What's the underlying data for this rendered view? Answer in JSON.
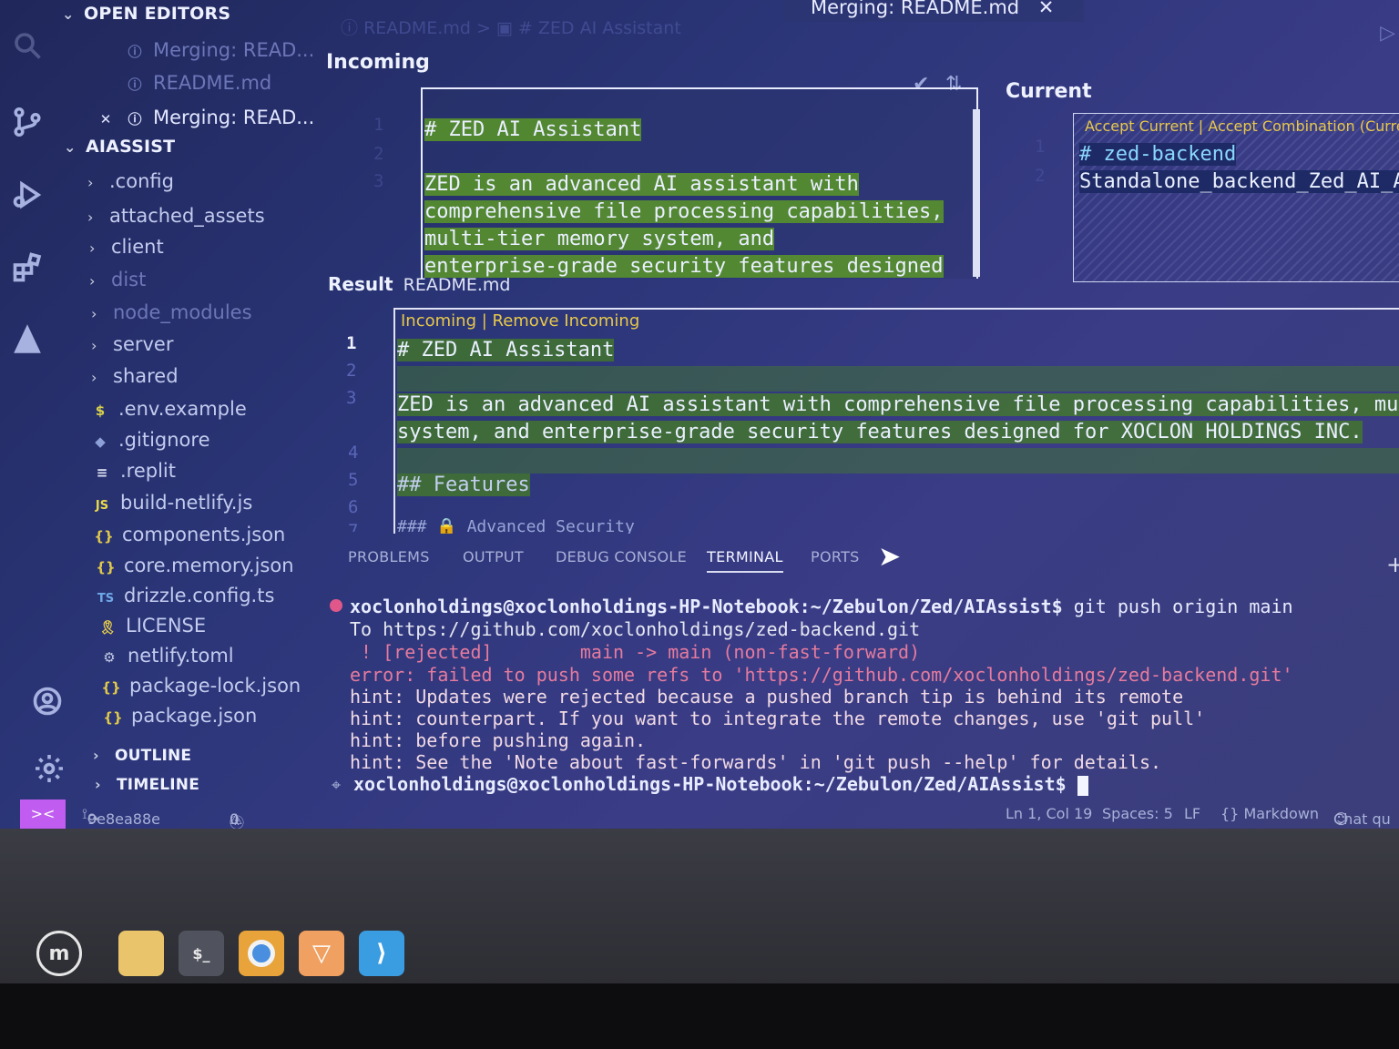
{
  "explorer": {
    "open_editors_header": "OPEN EDITORS",
    "open_editors": [
      {
        "label": "Merging: READ..."
      },
      {
        "label": "README.md"
      },
      {
        "label": "Merging: READ..."
      }
    ],
    "project_header": "AIASSIST",
    "folders": [
      ".config",
      "attached_assets",
      "client",
      "dist",
      "node_modules",
      "server",
      "shared"
    ],
    "files": [
      {
        "icon": "$",
        "label": ".env.example"
      },
      {
        "icon": "◆",
        "label": ".gitignore"
      },
      {
        "icon": "≡",
        "label": ".replit"
      },
      {
        "icon": "JS",
        "label": "build-netlify.js"
      },
      {
        "icon": "{}",
        "label": "components.json"
      },
      {
        "icon": "{}",
        "label": "core.memory.json"
      },
      {
        "icon": "TS",
        "label": "drizzle.config.ts"
      },
      {
        "icon": "🎗",
        "label": "LICENSE"
      },
      {
        "icon": "⚙",
        "label": "netlify.toml"
      },
      {
        "icon": "{}",
        "label": "package-lock.json"
      },
      {
        "icon": "{}",
        "label": "package.json"
      }
    ],
    "outline_header": "OUTLINE",
    "timeline_header": "TIMELINE"
  },
  "tab": {
    "title": "Merging: README.md",
    "close": "✕"
  },
  "breadcrumb": {
    "file": "README.md",
    "sep": ">",
    "section": "# ZED AI Assistant"
  },
  "incoming": {
    "title": "Incoming",
    "line_numbers": [
      "1",
      "2",
      "3"
    ],
    "lines": [
      "# ZED AI Assistant",
      "",
      "ZED is an advanced AI assistant with",
      "comprehensive file processing capabilities,",
      "multi-tier memory system, and",
      "enterprise-grade security features designed"
    ]
  },
  "current": {
    "title": "Current",
    "codelens": "Accept Current | Accept Combination (Curren",
    "line_numbers": [
      "1",
      "2"
    ],
    "lines": [
      "# zed-backend",
      "Standalone_backend_Zed_AI_Ass"
    ]
  },
  "result": {
    "title": "Result",
    "file": "README.md",
    "codelens": "Incoming | Remove Incoming",
    "line_numbers": [
      "1",
      "2",
      "3",
      "4",
      "5",
      "6",
      "7"
    ],
    "lines": [
      "# ZED AI Assistant",
      "",
      "ZED is an advanced AI assistant with comprehensive file processing capabilities, multi-ti",
      "system, and enterprise-grade security features designed for XOCLON HOLDINGS INC.",
      "",
      "## Features",
      "### 🔒 Advanced Security"
    ]
  },
  "panel": {
    "tabs": [
      "PROBLEMS",
      "OUTPUT",
      "DEBUG CONSOLE",
      "TERMINAL",
      "PORTS"
    ],
    "active_tab": "TERMINAL",
    "add": "+"
  },
  "terminal": {
    "prompt": "xoclonholdings@xoclonholdings-HP-Notebook:~/Zebulon/Zed/AIAssist$",
    "command": " git push origin main",
    "output": [
      {
        "text": "To https://github.com/xoclonholdings/zed-backend.git",
        "color": "#e6e8f2"
      },
      {
        "text": " ! [rejected]        main -> main (non-fast-forward)",
        "color": "#e57b9e"
      },
      {
        "text": "error: failed to push some refs to 'https://github.com/xoclonholdings/zed-backend.git'",
        "color": "#e57b9e"
      },
      {
        "text": "hint: Updates were rejected because a pushed branch tip is behind its remote",
        "color": "#f0d9e4"
      },
      {
        "text": "hint: counterpart. If you want to integrate the remote changes, use 'git pull'",
        "color": "#f0d9e4"
      },
      {
        "text": "hint: before pushing again.",
        "color": "#f0d9e4"
      },
      {
        "text": "hint: See the 'Note about fast-forwards' in 'git push --help' for details.",
        "color": "#f0d9e4"
      }
    ],
    "final_prompt": "xoclonholdings@xoclonholdings-HP-Notebook:~/Zebulon/Zed/AIAssist$"
  },
  "status": {
    "remote": "><",
    "branch": "9e8ea88e",
    "sync": "⟳",
    "errors": "0",
    "warnings": "0",
    "position": "Ln 1, Col 19",
    "spaces": "Spaces: 5",
    "eol": "LF",
    "language": "{} Markdown",
    "chat": "Chat qu"
  },
  "colors": {
    "accent": "#c15cf0",
    "merge_green": "#5a9628",
    "terminal_error": "#e57b9e",
    "terminal_prompt": "#e8ecff"
  }
}
